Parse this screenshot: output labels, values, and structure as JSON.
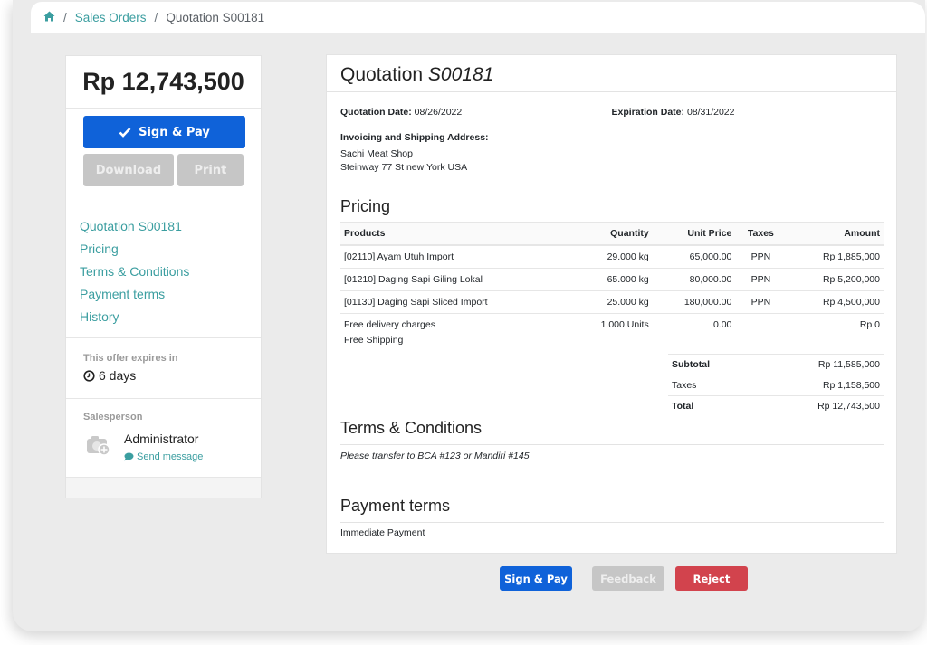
{
  "breadcrumb": {
    "home_icon": "home-icon",
    "items": [
      "Sales Orders",
      "Quotation S00181"
    ]
  },
  "sidebar": {
    "total": "Rp 12,743,500",
    "sign_pay_label": "Sign & Pay",
    "download_label": "Download",
    "print_label": "Print",
    "nav": [
      "Quotation S00181",
      "Pricing",
      "Terms & Conditions",
      "Payment terms",
      "History"
    ],
    "expires_label": "This offer expires in",
    "expires_value": "6 days",
    "salesperson_label": "Salesperson",
    "salesperson_name": "Administrator",
    "send_message_label": "Send message"
  },
  "document": {
    "title_prefix": "Quotation",
    "title_number": "S00181",
    "quotation_date_label": "Quotation Date:",
    "quotation_date": "08/26/2022",
    "expiration_date_label": "Expiration Date:",
    "expiration_date": "08/31/2022",
    "address_label": "Invoicing and Shipping Address:",
    "address_lines": [
      "Sachi Meat Shop",
      "Steinway 77 St new York USA"
    ],
    "pricing_title": "Pricing",
    "columns": [
      "Products",
      "Quantity",
      "Unit Price",
      "Taxes",
      "Amount"
    ],
    "lines": [
      {
        "product": "[02110] Ayam Utuh Import",
        "note": "",
        "quantity": "29.000 kg",
        "unit_price": "65,000.00",
        "taxes": "PPN",
        "amount": "Rp 1,885,000"
      },
      {
        "product": "[01210] Daging Sapi Giling Lokal",
        "note": "",
        "quantity": "65.000 kg",
        "unit_price": "80,000.00",
        "taxes": "PPN",
        "amount": "Rp 5,200,000"
      },
      {
        "product": "[01130] Daging Sapi Sliced Import",
        "note": "",
        "quantity": "25.000 kg",
        "unit_price": "180,000.00",
        "taxes": "PPN",
        "amount": "Rp 4,500,000"
      },
      {
        "product": "Free delivery charges",
        "note": "Free Shipping",
        "quantity": "1.000 Units",
        "unit_price": "0.00",
        "taxes": "",
        "amount": "Rp 0"
      }
    ],
    "totals": {
      "subtotal_label": "Subtotal",
      "subtotal": "Rp 11,585,000",
      "taxes_label": "Taxes",
      "taxes": "Rp 1,158,500",
      "total_label": "Total",
      "total": "Rp 12,743,500"
    },
    "terms_title": "Terms & Conditions",
    "terms_text": "Please transfer to BCA #123 or Mandiri #145",
    "payment_title": "Payment terms",
    "payment_text": "Immediate Payment"
  },
  "actions": {
    "sign_pay": "Sign & Pay",
    "feedback": "Feedback",
    "reject": "Reject"
  },
  "colors": {
    "primary": "#0f62d9",
    "link": "#3b9ea0",
    "danger": "#d2434d",
    "disabled": "#c6c6c6"
  }
}
